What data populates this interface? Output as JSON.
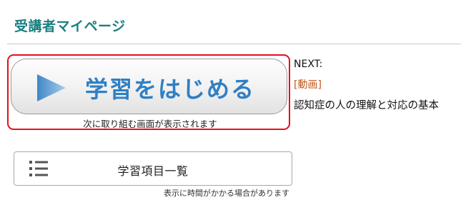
{
  "header": {
    "title": "受講者マイページ"
  },
  "start": {
    "label": "学習をはじめる",
    "icon": "play-icon",
    "note": "次に取り組む画面が表示されます"
  },
  "next": {
    "heading": "NEXT:",
    "type": "[動画]",
    "title": "認知症の人の理解と対応の基本"
  },
  "list": {
    "label": "学習項目一覧",
    "icon": "list-icon",
    "note": "表示に時間がかかる場合があります"
  },
  "colors": {
    "title": "#1a7f7f",
    "highlight_frame": "#e3101c",
    "start_label": "#2f7fc5",
    "next_type": "#c0561a"
  }
}
